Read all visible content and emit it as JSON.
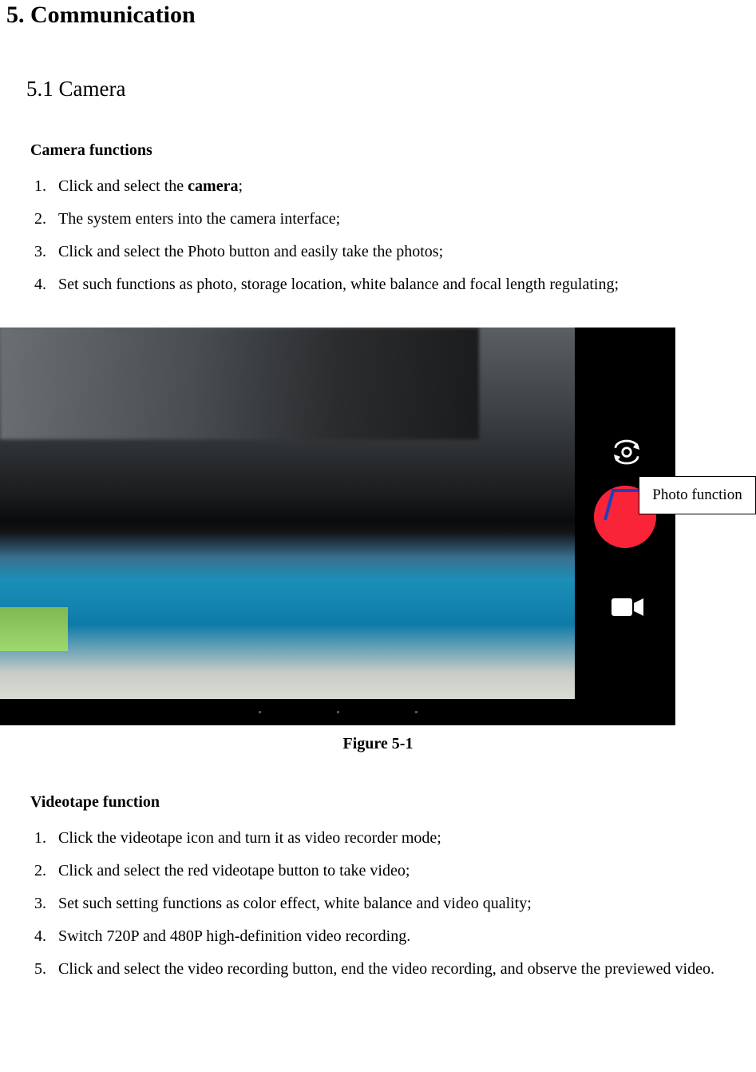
{
  "heading_main": "5. Communication",
  "heading_sub": "5.1 Camera",
  "section1": {
    "title": "Camera functions",
    "items": [
      {
        "prefix": "Click and select the ",
        "bold": "camera",
        "suffix": ";"
      },
      {
        "text": "The system enters into the camera interface;"
      },
      {
        "text": "Click and select the Photo button and easily take the photos;"
      },
      {
        "text": "Set such functions as photo, storage location, white balance and focal length regulating;"
      }
    ]
  },
  "figure": {
    "caption": "Figure 5-1",
    "callout": "Photo function"
  },
  "section2": {
    "title": "Videotape function",
    "items": [
      {
        "text": "Click the videotape icon and turn it as video recorder mode;"
      },
      {
        "text": "Click and select the red videotape button to take video;"
      },
      {
        "text": "Set such setting functions as color effect, white balance and video quality;"
      },
      {
        "text": "Switch 720P and 480P high-definition video recording."
      },
      {
        "text": "Click and select the video recording button, end the video recording, and observe the previewed video."
      }
    ]
  }
}
